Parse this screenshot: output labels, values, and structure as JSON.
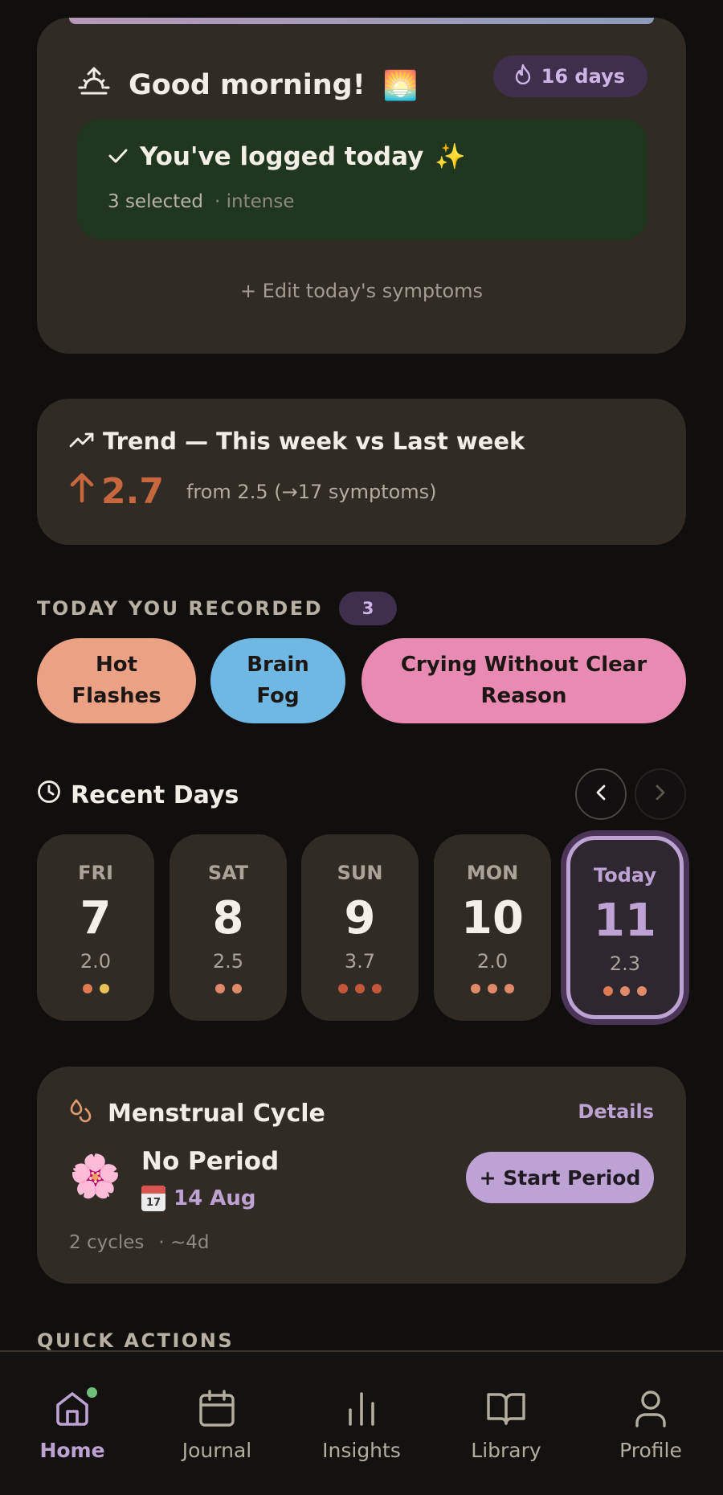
{
  "greeting": {
    "title": "Good morning!",
    "title_emoji": "🌅",
    "streak_label": "16 days",
    "logged_title": "You've logged today",
    "logged_emoji": "✨",
    "logged_count": "3 selected",
    "logged_intensity": "· intense",
    "edit_link": "+ Edit today's symptoms"
  },
  "trend": {
    "title": "Trend — This week vs Last week",
    "value": "2.7",
    "direction": "up",
    "from_text": "from 2.5 (→17 symptoms)"
  },
  "today_recorded": {
    "label": "TODAY YOU RECORDED",
    "count": "3",
    "chips": [
      {
        "line1": "Hot",
        "line2": "Flashes",
        "color": "#eba184"
      },
      {
        "line1": "Brain",
        "line2": "Fog",
        "color": "#6fb8e4"
      },
      {
        "line1": "Crying Without Clear",
        "line2": "Reason",
        "color": "#e98ab2"
      }
    ]
  },
  "recent_days": {
    "title": "Recent Days",
    "days": [
      {
        "dow": "FRI",
        "num": "7",
        "score": "2.0",
        "dots": [
          "#e07a52",
          "#e8c257"
        ]
      },
      {
        "dow": "SAT",
        "num": "8",
        "score": "2.5",
        "dots": [
          "#e08a6a",
          "#e08a6a"
        ]
      },
      {
        "dow": "SUN",
        "num": "9",
        "score": "3.7",
        "dots": [
          "#c4573a",
          "#c4573a",
          "#c4573a"
        ]
      },
      {
        "dow": "MON",
        "num": "10",
        "score": "2.0",
        "dots": [
          "#e08a6a",
          "#e08a6a",
          "#e08a6a"
        ]
      },
      {
        "dow": "Today",
        "num": "11",
        "score": "2.3",
        "dots": [
          "#e07a52",
          "#e08a6a",
          "#e08a6a"
        ]
      }
    ]
  },
  "cycle": {
    "title": "Menstrual Cycle",
    "details": "Details",
    "status": "No Period",
    "flower": "🌸",
    "cal_day": "17",
    "date": "14 Aug",
    "start_button": "+ Start Period",
    "cycles": "2 cycles",
    "avg": "· ~4d"
  },
  "quick_actions": {
    "label": "QUICK ACTIONS"
  },
  "nav": {
    "items": [
      {
        "label": "Home",
        "icon": "home-icon",
        "active": true
      },
      {
        "label": "Journal",
        "icon": "calendar-icon"
      },
      {
        "label": "Insights",
        "icon": "bar-chart-icon"
      },
      {
        "label": "Library",
        "icon": "book-icon"
      },
      {
        "label": "Profile",
        "icon": "user-icon"
      }
    ]
  },
  "colors": {
    "accent": "#bda3d3",
    "trend_up": "#c7673e",
    "logged_bg": "#20361f",
    "card_bg": "#312b25"
  }
}
